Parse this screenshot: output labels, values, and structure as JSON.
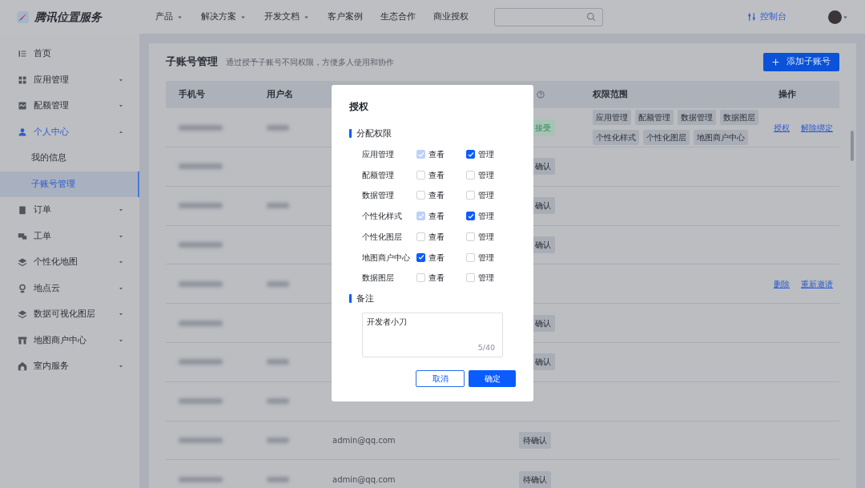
{
  "navbar": {
    "logo_text": "腾讯位置服务",
    "menu": [
      {
        "label": "产品",
        "dropdown": true
      },
      {
        "label": "解决方案",
        "dropdown": true
      },
      {
        "label": "开发文档",
        "dropdown": true
      },
      {
        "label": "客户案例",
        "dropdown": false
      },
      {
        "label": "生态合作",
        "dropdown": false
      },
      {
        "label": "商业授权",
        "dropdown": false
      }
    ],
    "console": "控制台"
  },
  "sidebar": {
    "items": [
      {
        "label": "首页",
        "kind": "link",
        "active": false
      },
      {
        "label": "应用管理",
        "kind": "menu",
        "active": false,
        "expanded": false
      },
      {
        "label": "配额管理",
        "kind": "menu",
        "active": false,
        "expanded": false
      },
      {
        "label": "个人中心",
        "kind": "menu",
        "active": true,
        "expanded": true,
        "children": [
          {
            "label": "我的信息",
            "selected": false
          },
          {
            "label": "子账号管理",
            "selected": true
          }
        ]
      },
      {
        "label": "订单",
        "kind": "menu",
        "active": false,
        "expanded": false
      },
      {
        "label": "工单",
        "kind": "menu",
        "active": false,
        "expanded": false
      },
      {
        "label": "个性化地图",
        "kind": "menu",
        "active": false,
        "expanded": false
      },
      {
        "label": "地点云",
        "kind": "menu",
        "active": false,
        "expanded": false
      },
      {
        "label": "数据可视化图层",
        "kind": "menu",
        "active": false,
        "expanded": false
      },
      {
        "label": "地图商户中心",
        "kind": "menu",
        "active": false,
        "expanded": false
      },
      {
        "label": "室内服务",
        "kind": "menu",
        "active": false,
        "expanded": false
      }
    ]
  },
  "page": {
    "title": "子账号管理",
    "subtitle": "通过授予子账号不同权限，方便多人使用和协作",
    "add_button": "添加子账号"
  },
  "table": {
    "columns": [
      {
        "label": "手机号"
      },
      {
        "label": "用户名"
      },
      {},
      {
        "help": true
      },
      {
        "label": "权限范围"
      },
      {
        "label": "操作"
      }
    ],
    "rows": [
      {
        "username_blurred": true,
        "status": {
          "text": "接受",
          "kind": "accepted"
        },
        "scopes": [
          "应用管理",
          "配额管理",
          "数据管理",
          "数据图层",
          "个性化样式",
          "个性化图层",
          "地图商户中心"
        ],
        "actions": [
          "授权",
          "解除绑定"
        ]
      },
      {
        "username_blurred": false,
        "status": {
          "text": "确认",
          "kind": "pending"
        }
      },
      {
        "username_blurred": true,
        "status": {
          "text": "确认",
          "kind": "pending"
        }
      },
      {
        "username_blurred": false,
        "status": {
          "text": "确认",
          "kind": "pending"
        }
      },
      {
        "username_blurred": true,
        "actions": [
          "删除",
          "重新邀请"
        ]
      },
      {
        "username_blurred": false,
        "status": {
          "text": "确认",
          "kind": "pending"
        }
      },
      {
        "username_blurred": true,
        "status": {
          "text": "确认",
          "kind": "pending"
        }
      },
      {
        "username_blurred": true
      },
      {
        "username_blurred": true,
        "email": "admin@qq.com",
        "status": {
          "text": "待确认",
          "kind": "pending"
        }
      },
      {
        "username_blurred": true,
        "email": "admin@qq.com",
        "status": {
          "text": "待确认",
          "kind": "pending"
        }
      }
    ]
  },
  "modal": {
    "title": "授权",
    "permissions_title": "分配权限",
    "permissions": [
      {
        "label": "应用管理",
        "view": {
          "label": "查看",
          "checked": true,
          "disabled": true
        },
        "manage": {
          "label": "管理",
          "checked": true,
          "disabled": false
        }
      },
      {
        "label": "配额管理",
        "view": {
          "label": "查看",
          "checked": false,
          "disabled": false
        },
        "manage": {
          "label": "管理",
          "checked": false,
          "disabled": false
        }
      },
      {
        "label": "数据管理",
        "view": {
          "label": "查看",
          "checked": false,
          "disabled": false
        },
        "manage": {
          "label": "管理",
          "checked": false,
          "disabled": false
        }
      },
      {
        "label": "个性化样式",
        "view": {
          "label": "查看",
          "checked": true,
          "disabled": true
        },
        "manage": {
          "label": "管理",
          "checked": true,
          "disabled": false
        }
      },
      {
        "label": "个性化图层",
        "view": {
          "label": "查看",
          "checked": false,
          "disabled": false
        },
        "manage": {
          "label": "管理",
          "checked": false,
          "disabled": false
        }
      },
      {
        "label": "地图商户中心",
        "view": {
          "label": "查看",
          "checked": true,
          "disabled": false
        },
        "manage": {
          "label": "管理",
          "checked": false,
          "disabled": false
        }
      },
      {
        "label": "数据图层",
        "view": {
          "label": "查看",
          "checked": false,
          "disabled": false
        },
        "manage": {
          "label": "管理",
          "checked": false,
          "disabled": false
        }
      }
    ],
    "note_title": "备注",
    "note_value": "开发者小刀",
    "note_counter": "5/40",
    "buttons": {
      "cancel": "取消",
      "confirm": "确定"
    }
  }
}
